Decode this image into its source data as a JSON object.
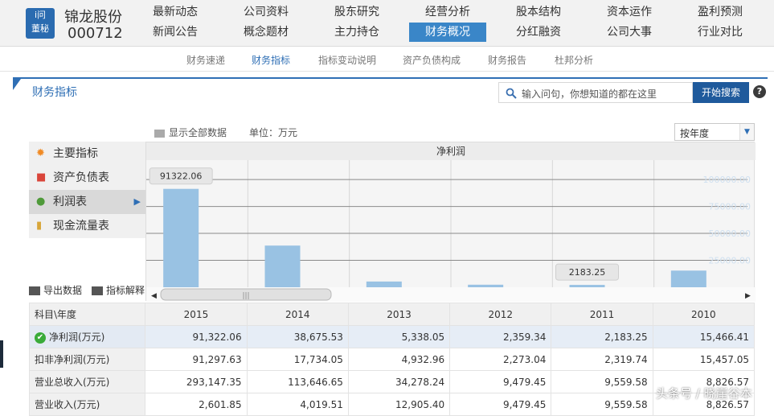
{
  "header": {
    "logo_top": "i问",
    "logo_bottom": "董秘",
    "company_name": "锦龙股份",
    "company_code": "000712",
    "nav_row1": [
      "最新动态",
      "公司资料",
      "股东研究",
      "经营分析",
      "股本结构",
      "资本运作",
      "盈利预测"
    ],
    "nav_row2": [
      "新闻公告",
      "概念题材",
      "主力持仓",
      "财务概况",
      "分红融资",
      "公司大事",
      "行业对比"
    ],
    "active_nav": "财务概况"
  },
  "subnav": [
    "财务速递",
    "财务指标",
    "指标变动说明",
    "资产负债构成",
    "财务报告",
    "杜邦分析"
  ],
  "active_subnav": "财务指标",
  "panel": {
    "title": "财务指标",
    "search_placeholder": "输入问句，你想知道的都在这里",
    "search_button": "开始搜索",
    "help": "?",
    "show_all": "显示全部数据",
    "unit": "单位：万元",
    "period_select": "按年度",
    "export": "导出数据",
    "explain": "指标解释"
  },
  "sidebar": [
    {
      "label": "主要指标",
      "icon": "gear-icon"
    },
    {
      "label": "资产负债表",
      "icon": "document-icon"
    },
    {
      "label": "利润表",
      "icon": "pie-chart-icon",
      "active": true
    },
    {
      "label": "现金流量表",
      "icon": "coins-icon"
    }
  ],
  "chart_data": {
    "type": "bar",
    "title": "净利润",
    "categories": [
      "2015",
      "2014",
      "2013",
      "2012",
      "2011",
      "2010"
    ],
    "values": [
      91322.06,
      38675.53,
      5338.05,
      2359.34,
      2183.25,
      15466.41
    ],
    "ylim": [
      0,
      115000
    ],
    "yticks": [
      "100000.00",
      "75000.00",
      "50000.00",
      "25000.00"
    ],
    "ytick_values": [
      100000,
      75000,
      50000,
      25000
    ],
    "tooltips": [
      {
        "category": "2015",
        "text": "91322.06"
      },
      {
        "category": "2011",
        "text": "2183.25"
      }
    ],
    "bar_color": "#99c2e3",
    "grid": true
  },
  "table": {
    "header": [
      "科目\\年度",
      "2015",
      "2014",
      "2013",
      "2012",
      "2011",
      "2010"
    ],
    "rows": [
      {
        "label": "净利润(万元)",
        "values": [
          "91,322.06",
          "38,675.53",
          "5,338.05",
          "2,359.34",
          "2,183.25",
          "15,466.41"
        ],
        "selected": true
      },
      {
        "label": "扣非净利润(万元)",
        "values": [
          "91,297.63",
          "17,734.05",
          "4,932.96",
          "2,273.04",
          "2,319.74",
          "15,457.05"
        ]
      },
      {
        "label": "营业总收入(万元)",
        "values": [
          "293,147.35",
          "113,646.65",
          "34,278.24",
          "9,479.45",
          "9,559.58",
          "8,826.57"
        ]
      },
      {
        "label": "营业收入(万元)",
        "values": [
          "2,601.85",
          "4,019.51",
          "12,905.40",
          "9,479.45",
          "9,559.58",
          "8,826.57"
        ]
      }
    ]
  },
  "watermark": "头条号 / 晓崖谷本"
}
